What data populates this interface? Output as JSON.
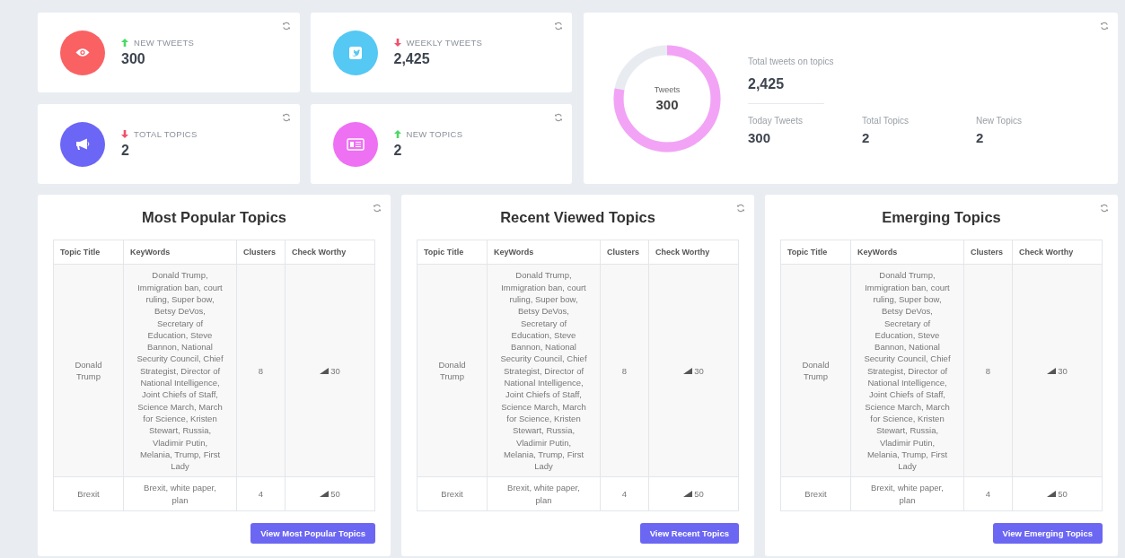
{
  "stats": [
    {
      "label": "NEW TWEETS",
      "value": "300",
      "rising": true,
      "kind": "eye",
      "color": "#fa6163"
    },
    {
      "label": "WEEKLY TWEETS",
      "value": "2,425",
      "rising": false,
      "kind": "bird",
      "color": "#55c8f3"
    },
    {
      "label": "TOTAL TOPICS",
      "value": "2",
      "rising": false,
      "kind": "megaphone",
      "color": "#6b66f5"
    },
    {
      "label": "NEW TOPICS",
      "value": "2",
      "rising": true,
      "kind": "news",
      "color": "#ee70f3"
    }
  ],
  "summary": {
    "donut": {
      "label": "Tweets",
      "value": "300"
    },
    "total_label": "Total tweets on topics",
    "total_value": "2,425",
    "metrics": [
      {
        "label": "Today Tweets",
        "value": "300"
      },
      {
        "label": "Total Topics",
        "value": "2"
      },
      {
        "label": "New Topics",
        "value": "2"
      }
    ]
  },
  "panels": [
    {
      "title": "Most Popular Topics",
      "columns": [
        "Topic Title",
        "KeyWords",
        "Clusters",
        "Check Worthy"
      ],
      "rows": [
        {
          "title": "Donald Trump",
          "keywords": "Donald Trump, Immigration ban, court ruling, Super bow, Betsy DeVos, Secretary of Education, Steve Bannon, National Security Council, Chief Strategist, Director of National Intelligence, Joint Chiefs of Staff, Science March, March for Science, Kristen Stewart, Russia, Vladimir Putin, Melania, Trump, First Lady",
          "clusters": "8",
          "check_worthy": "30"
        },
        {
          "title": "Brexit",
          "keywords": "Brexit, white paper, plan",
          "clusters": "4",
          "check_worthy": "50"
        }
      ],
      "button": "View Most Popular Topics"
    },
    {
      "title": "Recent Viewed Topics",
      "columns": [
        "Topic Title",
        "KeyWords",
        "Clusters",
        "Check Worthy"
      ],
      "rows": [
        {
          "title": "Donald Trump",
          "keywords": "Donald Trump, Immigration ban, court ruling, Super bow, Betsy DeVos, Secretary of Education, Steve Bannon, National Security Council, Chief Strategist, Director of National Intelligence, Joint Chiefs of Staff, Science March, March for Science, Kristen Stewart, Russia, Vladimir Putin, Melania, Trump, First Lady",
          "clusters": "8",
          "check_worthy": "30"
        },
        {
          "title": "Brexit",
          "keywords": "Brexit, white paper, plan",
          "clusters": "4",
          "check_worthy": "50"
        }
      ],
      "button": "View Recent Topics"
    },
    {
      "title": "Emerging Topics",
      "columns": [
        "Topic Title",
        "KeyWords",
        "Clusters",
        "Check Worthy"
      ],
      "rows": [
        {
          "title": "Donald Trump",
          "keywords": "Donald Trump, Immigration ban, court ruling, Super bow, Betsy DeVos, Secretary of Education, Steve Bannon, National Security Council, Chief Strategist, Director of National Intelligence, Joint Chiefs of Staff, Science March, March for Science, Kristen Stewart, Russia, Vladimir Putin, Melania, Trump, First Lady",
          "clusters": "8",
          "check_worthy": "30"
        },
        {
          "title": "Brexit",
          "keywords": "Brexit, white paper, plan",
          "clusters": "4",
          "check_worthy": "50"
        }
      ],
      "button": "View Emerging Topics"
    }
  ]
}
